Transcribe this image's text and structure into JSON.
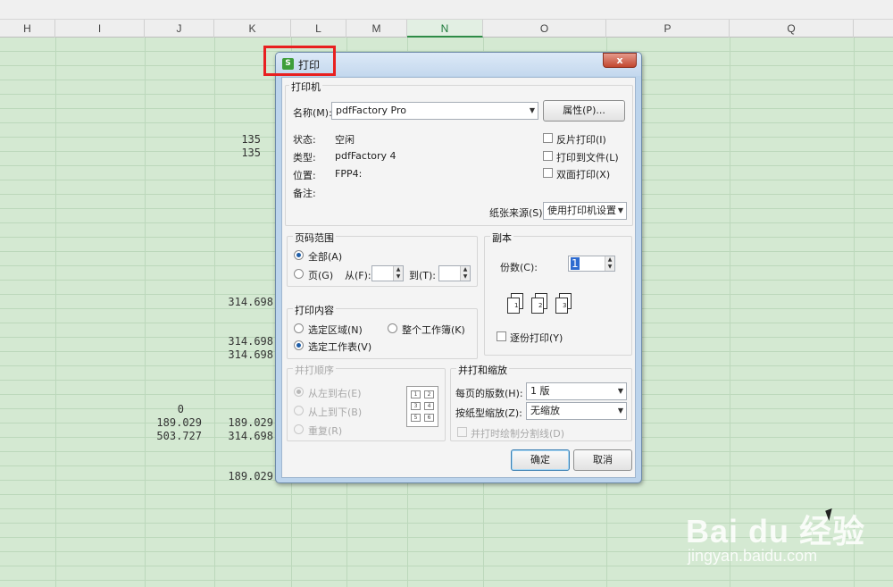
{
  "sheet": {
    "columns": [
      "H",
      "I",
      "J",
      "K",
      "L",
      "M",
      "N",
      "O",
      "P",
      "Q"
    ],
    "selected_column": "N",
    "cells": {
      "k_135_a": "135",
      "k_135_b": "135",
      "k_314_a": "314.698",
      "k_314_b": "314.698",
      "k_314_c": "314.698",
      "j_0": "0",
      "j_189": "189.029",
      "k_189": "189.029",
      "j_503": "503.727",
      "k_314_d": "314.698",
      "k_189_b": "189.029"
    },
    "grid_color": "#bcd8bb",
    "background": "#d4e9d2"
  },
  "dialog": {
    "title": "打印",
    "title_icon": "S",
    "close_label": "x",
    "printer": {
      "group": "打印机",
      "name_label": "名称(M):",
      "name_value": "pdfFactory Pro",
      "properties_btn": "属性(P)...",
      "status_label": "状态:",
      "status_value": "空闲",
      "type_label": "类型:",
      "type_value": "pdfFactory 4",
      "where_label": "位置:",
      "where_value": "FPP4:",
      "comment_label": "备注:",
      "reverse_print": "反片打印(I)",
      "print_to_file": "打印到文件(L)",
      "duplex": "双面打印(X)",
      "paper_source_label": "纸张来源(S):",
      "paper_source_value": "使用打印机设置"
    },
    "page_range": {
      "group": "页码范围",
      "all": "全部(A)",
      "pages": "页(G)",
      "from": "从(F):",
      "to": "到(T):"
    },
    "copies": {
      "group": "副本",
      "count_label": "份数(C):",
      "count_value": "1",
      "collate": "逐份打印(Y)",
      "collate_pages": [
        "1",
        "2",
        "3"
      ]
    },
    "print_what": {
      "group": "打印内容",
      "selection": "选定区域(N)",
      "workbook": "整个工作簿(K)",
      "sheet": "选定工作表(V)"
    },
    "order": {
      "group": "并打顺序",
      "left_right": "从左到右(E)",
      "top_bottom": "从上到下(B)",
      "repeat": "重复(R)",
      "layout_cells": [
        "1",
        "2",
        "3",
        "4",
        "5",
        "6"
      ]
    },
    "zoom": {
      "group": "并打和缩放",
      "pages_per_sheet_label": "每页的版数(H):",
      "pages_per_sheet_value": "1 版",
      "scale_label": "按纸型缩放(Z):",
      "scale_value": "无缩放",
      "draw_borders": "并打时绘制分割线(D)"
    },
    "ok": "确定",
    "cancel": "取消"
  },
  "watermark": {
    "logo": "Bai du 经验",
    "url": "jingyan.baidu.com"
  },
  "colors": {
    "highlight": "#e82020",
    "dialog_frame": "#bcd4ec",
    "accent_green": "#3e9e3a"
  }
}
